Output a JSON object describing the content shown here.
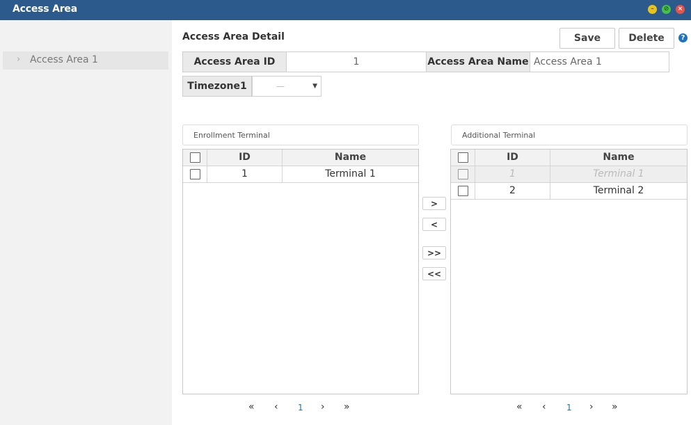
{
  "window": {
    "title": "Access Area",
    "controls": [
      "minimize-icon",
      "maximize-icon",
      "close-icon"
    ],
    "colors": {
      "titlebar": "#2d5a8c",
      "minimize": "#e8c31a",
      "maximize": "#45c04a",
      "close": "#e5534b"
    }
  },
  "sidebar": {
    "items": [
      {
        "label": "Access Area 1",
        "icon": "chevron-right-icon"
      }
    ]
  },
  "detail": {
    "title": "Access Area Detail",
    "save_label": "Save",
    "delete_label": "Delete",
    "help_icon": "?",
    "id_label": "Access Area ID",
    "id_value": "1",
    "name_label": "Access Area Name",
    "name_value": "Access Area 1",
    "timezone_label": "Timezone1",
    "timezone_value": "—"
  },
  "enrollment": {
    "title": "Enrollment Terminal",
    "columns": {
      "id": "ID",
      "name": "Name"
    },
    "rows": [
      {
        "id": "1",
        "name": "Terminal 1"
      }
    ],
    "pager": {
      "first": "«",
      "prev": "‹",
      "page": "1",
      "next": "›",
      "last": "»"
    }
  },
  "additional": {
    "title": "Additional Terminal",
    "columns": {
      "id": "ID",
      "name": "Name"
    },
    "rows": [
      {
        "id": "1",
        "name": "Terminal 1",
        "disabled": true
      },
      {
        "id": "2",
        "name": "Terminal 2",
        "disabled": false
      }
    ],
    "pager": {
      "first": "«",
      "prev": "‹",
      "page": "1",
      "next": "›",
      "last": "»"
    }
  },
  "transfer": {
    "move_right": ">",
    "move_left": "<",
    "move_all_right": ">>",
    "move_all_left": "<<"
  }
}
